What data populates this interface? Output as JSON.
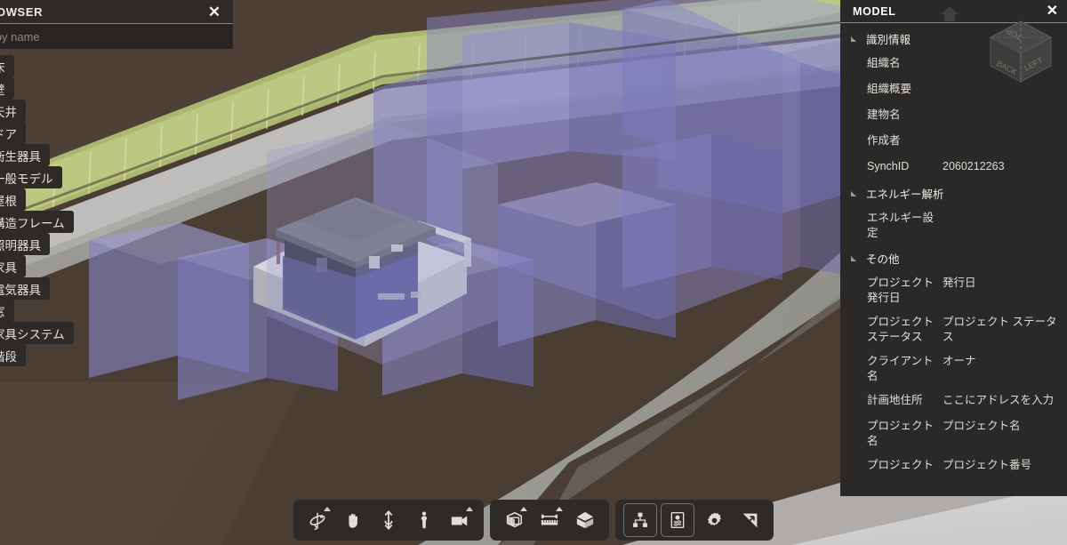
{
  "viewport": {
    "name": "3d-model-viewport",
    "colors": {
      "terrain_brown": "#4a3d33",
      "road_gray": "#9a9a94",
      "hedge_green": "#b9c47d",
      "volume_purple": "#6d6bb0",
      "volume_purple_light": "#8f8dc6",
      "building_dark": "#23232b",
      "roof_gray": "#6f7072",
      "pavement_light": "#c9c9cd"
    }
  },
  "browser": {
    "title": "BROWSER",
    "close_label": "✕",
    "filter_placeholder": "ter by name",
    "filter_value": "",
    "items": [
      {
        "label": "床"
      },
      {
        "label": "壁"
      },
      {
        "label": "天井"
      },
      {
        "label": "ドア"
      },
      {
        "label": "衛生器具"
      },
      {
        "label": "一般モデル"
      },
      {
        "label": "屋根"
      },
      {
        "label": "構造フレーム"
      },
      {
        "label": "照明器具"
      },
      {
        "label": "家具"
      },
      {
        "label": "電気器具"
      },
      {
        "label": "窓"
      },
      {
        "label": "家具システム"
      },
      {
        "label": "階段"
      }
    ]
  },
  "model_panel": {
    "title": "MODEL",
    "close_label": "✕",
    "groups": [
      {
        "label": "識別情報",
        "expanded": true,
        "properties": [
          {
            "key": "組織名",
            "value": ""
          },
          {
            "key": "組織概要",
            "value": ""
          },
          {
            "key": "建物名",
            "value": ""
          },
          {
            "key": "作成者",
            "value": ""
          },
          {
            "key": "SynchID",
            "value": "2060212263"
          }
        ]
      },
      {
        "label": "エネルギー解析",
        "expanded": true,
        "properties": [
          {
            "key": "エネルギー設定",
            "value": ""
          }
        ]
      },
      {
        "label": "その他",
        "expanded": true,
        "properties": [
          {
            "key": "プロジェクト発行日",
            "value": "発行日"
          },
          {
            "key": "プロジェクトステータス",
            "value": "プロジェクト ステータス"
          },
          {
            "key": "クライアント名",
            "value": "オーナ"
          },
          {
            "key": "計画地住所",
            "value": "ここにアドレスを入力"
          },
          {
            "key": "プロジェクト名",
            "value": "プロジェクト名"
          },
          {
            "key": "プロジェクト",
            "value": "プロジェクト番号"
          }
        ]
      }
    ]
  },
  "navcube": {
    "faces": {
      "top": "TOP",
      "back": "BACK",
      "left": "LEFT"
    }
  },
  "toolbar": {
    "groups": [
      {
        "name": "navigation-tools",
        "buttons": [
          {
            "name": "orbit-icon",
            "has_dropdown": true
          },
          {
            "name": "pan-hand-icon",
            "has_dropdown": false
          },
          {
            "name": "zoom-vertical-arrow-icon",
            "has_dropdown": false
          },
          {
            "name": "walk-person-icon",
            "has_dropdown": false
          },
          {
            "name": "camera-icon",
            "has_dropdown": true
          }
        ]
      },
      {
        "name": "model-tools",
        "buttons": [
          {
            "name": "section-box-icon",
            "has_dropdown": true
          },
          {
            "name": "measure-ruler-icon",
            "has_dropdown": true
          },
          {
            "name": "appearance-cube-icon",
            "has_dropdown": false
          }
        ]
      },
      {
        "name": "panel-tools",
        "buttons": [
          {
            "name": "model-tree-icon",
            "has_dropdown": false,
            "boxed": true
          },
          {
            "name": "properties-panel-icon",
            "has_dropdown": false,
            "boxed": true
          },
          {
            "name": "settings-gear-icon",
            "has_dropdown": false
          },
          {
            "name": "fullscreen-expand-icon",
            "has_dropdown": false
          }
        ]
      }
    ]
  }
}
